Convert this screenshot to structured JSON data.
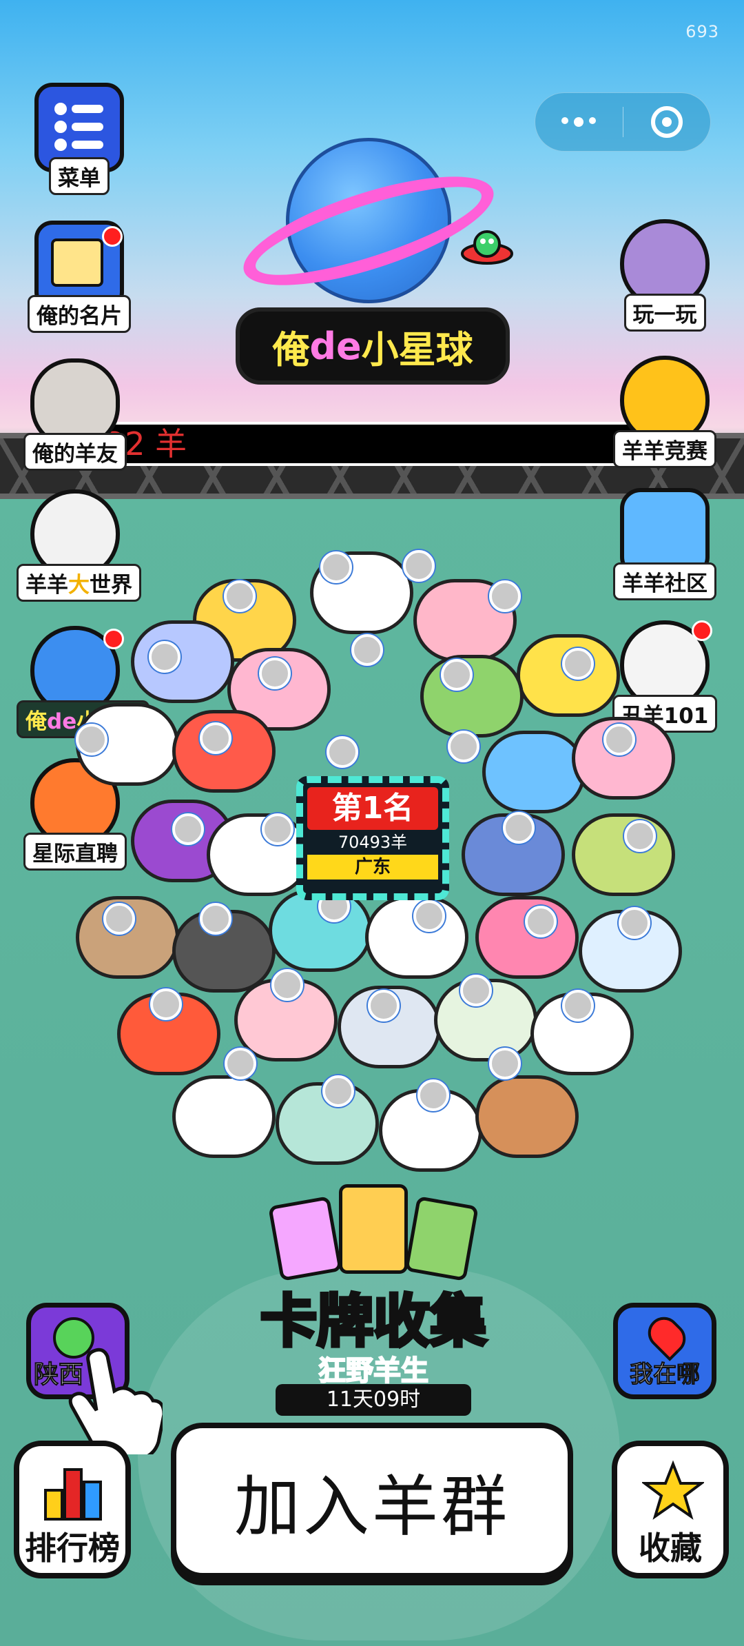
{
  "status": {
    "counter": "693"
  },
  "left_menu": [
    {
      "key": "menu",
      "label": "菜单",
      "icon": "menu-list-icon"
    },
    {
      "key": "card",
      "label": "俺的名片",
      "icon": "name-card-icon",
      "badge": true
    },
    {
      "key": "friends",
      "label": "俺的羊友",
      "icon": "sheep-friends-icon"
    },
    {
      "key": "world",
      "label": "羊羊大世界",
      "label_parts": [
        "羊羊",
        "大",
        "世界"
      ],
      "icon": "sheep-world-icon"
    },
    {
      "key": "planet",
      "label": "俺de小星球",
      "label_parts": [
        "俺",
        "de",
        "小星球"
      ],
      "icon": "planet-icon",
      "badge": true
    },
    {
      "key": "hire",
      "label": "星际直聘",
      "icon": "megaphone-icon"
    }
  ],
  "right_menu": [
    {
      "key": "play",
      "label": "玩一玩",
      "icon": "play-wolf-icon"
    },
    {
      "key": "contest",
      "label": "羊羊竞赛",
      "icon": "trophy-icon"
    },
    {
      "key": "community",
      "label": "羊羊社区",
      "icon": "community-icon"
    },
    {
      "key": "ugly",
      "label": "丑羊101",
      "icon": "ugly-sheep-icon",
      "badge": true
    }
  ],
  "planet_title": {
    "prefix": "俺",
    "mid": "de",
    "suffix": "小星球"
  },
  "ticker": {
    "text": "32 羊"
  },
  "rank": {
    "title": "第1名",
    "score": "70493羊",
    "region": "广东"
  },
  "event": {
    "title": "卡牌收集",
    "subtitle": "狂野羊生",
    "timer": "11天09时"
  },
  "bottom": {
    "province_label": "陕西",
    "location_label": "我在哪",
    "ranking_label": "排行榜",
    "join_label": "加入羊群",
    "favorite_label": "收藏"
  },
  "colors": {
    "bg_green": "#5aae99",
    "accent_yellow": "#ffe94d",
    "accent_pink": "#ff7be4",
    "rank_red": "#e8231d"
  }
}
